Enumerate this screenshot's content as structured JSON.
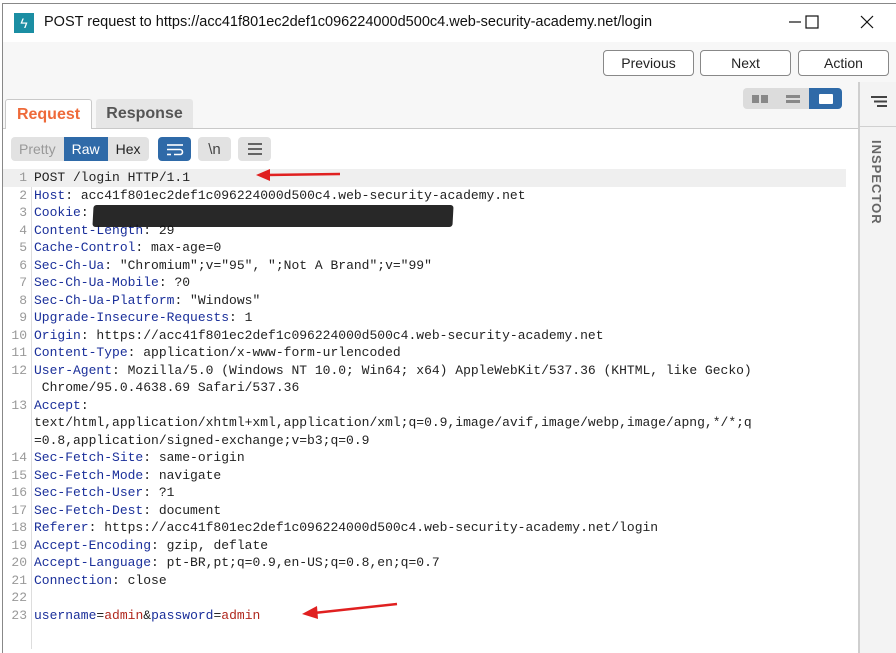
{
  "window": {
    "title": "POST request to https://acc41f801ec2def1c096224000d500c4.web-security-academy.net/login",
    "icon": "burp-lightning-icon",
    "controls": [
      "minimize",
      "maximize",
      "close"
    ]
  },
  "nav": {
    "previous": "Previous",
    "next": "Next",
    "action": "Action"
  },
  "tabs": [
    {
      "label": "Request",
      "active": true
    },
    {
      "label": "Response",
      "active": false
    }
  ],
  "layout_toggle": {
    "options": [
      "split-columns",
      "split-rows",
      "single-pane"
    ],
    "selected": "single-pane"
  },
  "inspector": {
    "label": "INSPECTOR"
  },
  "toolbar": {
    "views": [
      {
        "label": "Pretty",
        "active": false
      },
      {
        "label": "Raw",
        "active": true
      },
      {
        "label": "Hex",
        "active": false
      }
    ],
    "wrap_icon": "word-wrap-icon",
    "newline_label": "\\n",
    "menu_icon": "menu-icon"
  },
  "request_lines": [
    {
      "n": "1",
      "key": "",
      "value": "POST /login HTTP/1.1"
    },
    {
      "n": "2",
      "key": "Host",
      "value": "acc41f801ec2def1c096224000d500c4.web-security-academy.net"
    },
    {
      "n": "3",
      "key": "Cookie",
      "value": "[redacted]"
    },
    {
      "n": "4",
      "key": "Content-Length",
      "value": "29"
    },
    {
      "n": "5",
      "key": "Cache-Control",
      "value": "max-age=0"
    },
    {
      "n": "6",
      "key": "Sec-Ch-Ua",
      "value": "\"Chromium\";v=\"95\", \";Not A Brand\";v=\"99\""
    },
    {
      "n": "7",
      "key": "Sec-Ch-Ua-Mobile",
      "value": "?0"
    },
    {
      "n": "8",
      "key": "Sec-Ch-Ua-Platform",
      "value": "\"Windows\""
    },
    {
      "n": "9",
      "key": "Upgrade-Insecure-Requests",
      "value": "1"
    },
    {
      "n": "10",
      "key": "Origin",
      "value": "https://acc41f801ec2def1c096224000d500c4.web-security-academy.net"
    },
    {
      "n": "11",
      "key": "Content-Type",
      "value": "application/x-www-form-urlencoded"
    },
    {
      "n": "12",
      "key": "User-Agent",
      "value": "Mozilla/5.0 (Windows NT 10.0; Win64; x64) AppleWebKit/537.36 (KHTML, like Gecko)",
      "cont": [
        " Chrome/95.0.4638.69 Safari/537.36"
      ]
    },
    {
      "n": "13",
      "key": "Accept",
      "value": "",
      "cont": [
        "text/html,application/xhtml+xml,application/xml;q=0.9,image/avif,image/webp,image/apng,*/*;q",
        "=0.8,application/signed-exchange;v=b3;q=0.9"
      ]
    },
    {
      "n": "14",
      "key": "Sec-Fetch-Site",
      "value": "same-origin"
    },
    {
      "n": "15",
      "key": "Sec-Fetch-Mode",
      "value": "navigate"
    },
    {
      "n": "16",
      "key": "Sec-Fetch-User",
      "value": "?1"
    },
    {
      "n": "17",
      "key": "Sec-Fetch-Dest",
      "value": "document"
    },
    {
      "n": "18",
      "key": "Referer",
      "value": "https://acc41f801ec2def1c096224000d500c4.web-security-academy.net/login"
    },
    {
      "n": "19",
      "key": "Accept-Encoding",
      "value": "gzip, deflate"
    },
    {
      "n": "20",
      "key": "Accept-Language",
      "value": "pt-BR,pt;q=0.9,en-US;q=0.8,en;q=0.7"
    },
    {
      "n": "21",
      "key": "Connection",
      "value": "close"
    },
    {
      "n": "22",
      "key": "",
      "value": ""
    }
  ],
  "body_line": {
    "n": "23",
    "params": [
      {
        "name": "username",
        "value": "admin"
      },
      {
        "name": "password",
        "value": "admin"
      }
    ]
  },
  "annotations": {
    "arrow_color": "#e02020"
  }
}
